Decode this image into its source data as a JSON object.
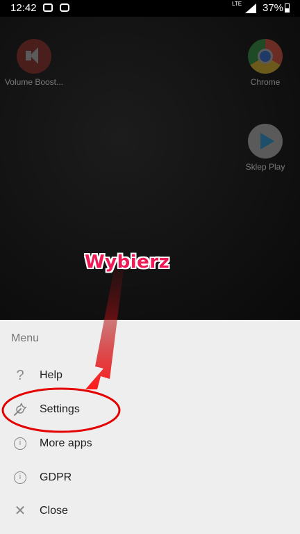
{
  "status_bar": {
    "time": "12:42",
    "network": "LTE",
    "battery_percent": "37%",
    "battery_level": 0.37
  },
  "home_screen": {
    "apps": [
      {
        "label": "Volume Boost..."
      },
      {
        "label": "Chrome"
      },
      {
        "label": "Sklep Play"
      }
    ]
  },
  "annotation": {
    "text": "Wybierz",
    "color": "#ef1a55"
  },
  "menu": {
    "title": "Menu",
    "items": [
      {
        "label": "Help",
        "icon": "help-icon"
      },
      {
        "label": "Settings",
        "icon": "wrench-icon"
      },
      {
        "label": "More apps",
        "icon": "info-icon"
      },
      {
        "label": "GDPR",
        "icon": "info-icon"
      },
      {
        "label": "Close",
        "icon": "close-icon"
      }
    ]
  }
}
